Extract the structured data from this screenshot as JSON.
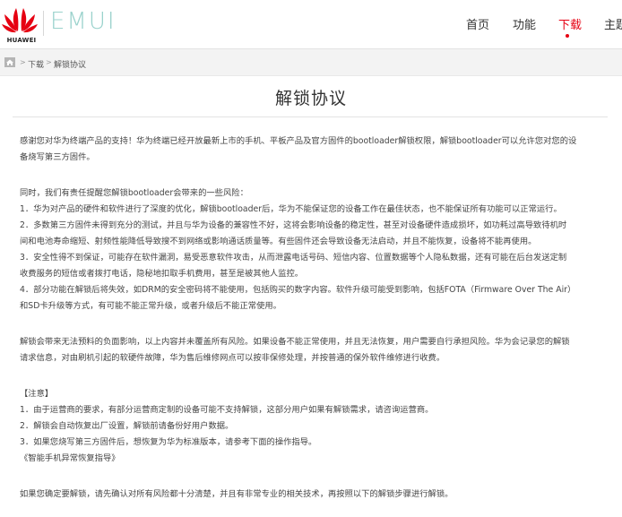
{
  "header": {
    "logo_text": "HUAWEI",
    "brand": "EMUI",
    "nav": [
      {
        "label": "首页",
        "active": false
      },
      {
        "label": "功能",
        "active": false
      },
      {
        "label": "下载",
        "active": true
      },
      {
        "label": "主题",
        "active": false
      }
    ]
  },
  "breadcrumb": {
    "items": [
      "下载",
      "解锁协议"
    ],
    "separator": ">"
  },
  "page": {
    "title": "解锁协议",
    "lines": [
      "感谢您对华为终端产品的支持！华为终端已经开放最新上市的手机、平板产品及官方固件的bootloader解锁权限，解锁bootloader可以允许您对您的设",
      "备烧写第三方固件。",
      "同时，我们有责任提醒您解锁bootloader会带来的一些风险：",
      "1．华为对产品的硬件和软件进行了深度的优化，解锁bootloader后，华为不能保证您的设备工作在最佳状态，也不能保证所有功能可以正常运行。",
      "2．多数第三方固件未得到充分的测试，并且与华为设备的兼容性不好，这将会影响设备的稳定性，甚至对设备硬件造成损坏，如功耗过高导致待机时",
      "间和电池寿命缩短、射频性能降低导致搜不到网络或影响通话质量等。有些固件还会导致设备无法启动，并且不能恢复，设备将不能再使用。",
      "3．安全性得不到保证，可能存在软件漏洞，易受恶意软件攻击，从而泄露电话号码、短信内容、位置数据等个人隐私数据，还有可能在后台发送定制",
      "收费服务的短信或者拨打电话，隐秘地扣取手机费用，甚至是被其他人监控。",
      "4．部分功能在解锁后将失效，如DRM的安全密码将不能使用，包括购买的数字内容。软件升级可能受到影响，包括FOTA（Firmware Over The Air）",
      "和SD卡升级等方式，有可能不能正常升级，或者升级后不能正常使用。",
      "解锁会带来无法预料的负面影响，以上内容并未覆盖所有风险。如果设备不能正常使用，并且无法恢复，用户需要自行承担风险。华为会记录您的解锁",
      "请求信息，对由刷机引起的软硬件故障，华为售后维修网点可以按非保修处理，并按普通的保外软件维修进行收费。",
      "【注意】",
      "1．由于运营商的要求，有部分运营商定制的设备可能不支持解锁，这部分用户如果有解锁需求，请咨询运营商。",
      "2．解锁会自动恢复出厂设置，解锁前请备份好用户数据。",
      "3．如果您烧写第三方固件后，想恢复为华为标准版本，请参考下面的操作指导。",
      "《智能手机异常恢复指导》",
      "如果您确定要解锁，请先确认对所有风险都十分清楚，并且有非常专业的相关技术，再按照以下的解锁步骤进行解锁。"
    ]
  }
}
